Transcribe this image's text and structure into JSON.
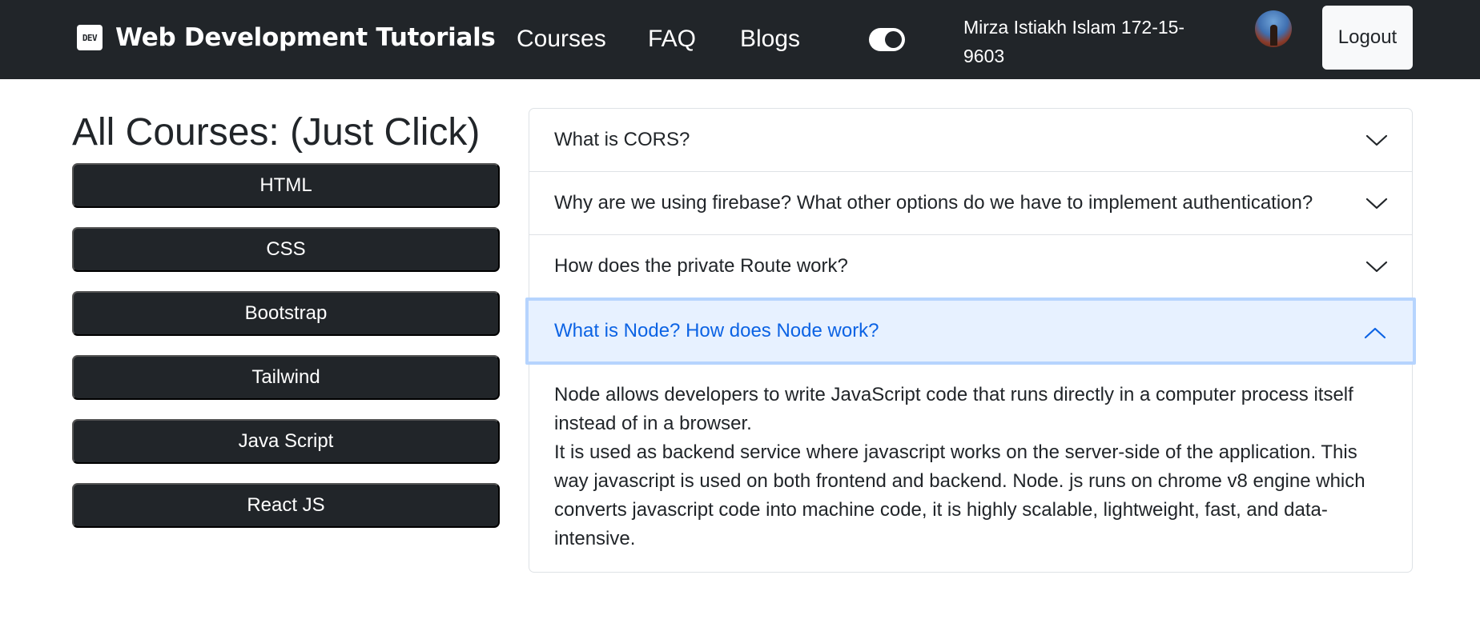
{
  "navbar": {
    "logo_text": "DEV",
    "brand": "Web Development Tutorials",
    "links": [
      "Courses",
      "FAQ",
      "Blogs"
    ],
    "toggle_on": true,
    "user_name": "Mirza Istiakh Islam 172-15-9603",
    "logout_label": "Logout",
    "colors": {
      "background": "#212529",
      "text": "#ffffff"
    }
  },
  "courses": {
    "heading": "All Courses: (Just Click)",
    "items": [
      "HTML",
      "CSS",
      "Bootstrap",
      "Tailwind",
      "Java Script",
      "React JS"
    ]
  },
  "faq": {
    "items": [
      {
        "question": "What is CORS?",
        "expanded": false
      },
      {
        "question": "Why are we using firebase? What other options do we have to implement authentication?",
        "expanded": false
      },
      {
        "question": "How does the private Route work?",
        "expanded": false
      },
      {
        "question": "What is Node? How does Node work?",
        "expanded": true
      }
    ],
    "answer_line1": "Node allows developers to write JavaScript code that runs directly in a computer process itself instead of in a browser.",
    "answer_line2": "It is used as backend service where javascript works on the server-side of the application. This way javascript is used on both frontend and backend. Node. js runs on chrome v8 engine which converts javascript code into machine code, it is highly scalable, lightweight, fast, and data-intensive.",
    "colors": {
      "active_bg": "#e7f1ff",
      "active_text": "#0c63e4",
      "active_border": "#b6d4fe"
    }
  },
  "icons": {
    "chevron_down": "chevron-down-icon",
    "chevron_up": "chevron-up-icon",
    "logo": "dev-logo-icon",
    "toggle": "theme-toggle"
  }
}
